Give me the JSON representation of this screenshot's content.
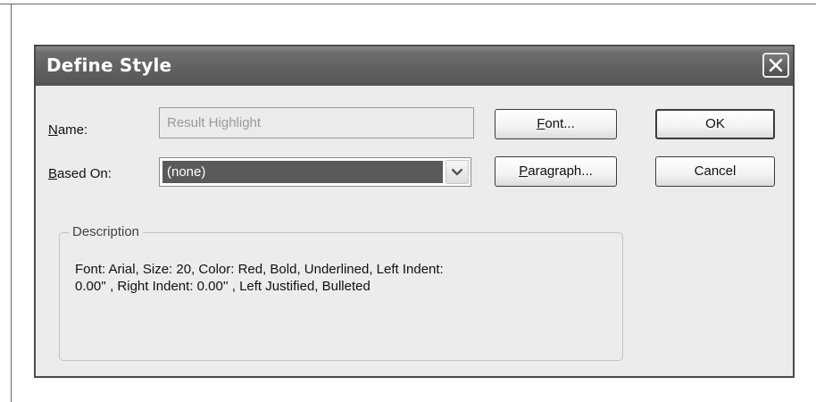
{
  "dialog": {
    "title": "Define Style",
    "close_icon": "close-icon"
  },
  "form": {
    "name_label_accel": "N",
    "name_label_rest": "ame:",
    "name_value": "Result Highlight",
    "based_on_label_accel": "B",
    "based_on_label_rest": "ased On:",
    "based_on_value": "(none)",
    "dropdown_icon": "chevron-down-icon"
  },
  "buttons": {
    "font_accel": "F",
    "font_rest": "ont...",
    "paragraph_accel": "P",
    "paragraph_rest": "aragraph...",
    "ok": "OK",
    "cancel": "Cancel"
  },
  "description": {
    "legend": "Description",
    "line1": "Font: Arial, Size: 20, Color: Red, Bold, Underlined, Left Indent:",
    "line2": "0.00'' , Right Indent: 0.00'' , Left Justified, Bulleted"
  },
  "colors": {
    "titlebar": "#5f5f5f",
    "dialog_bg": "#ececec",
    "selection": "#5a5a5a"
  }
}
